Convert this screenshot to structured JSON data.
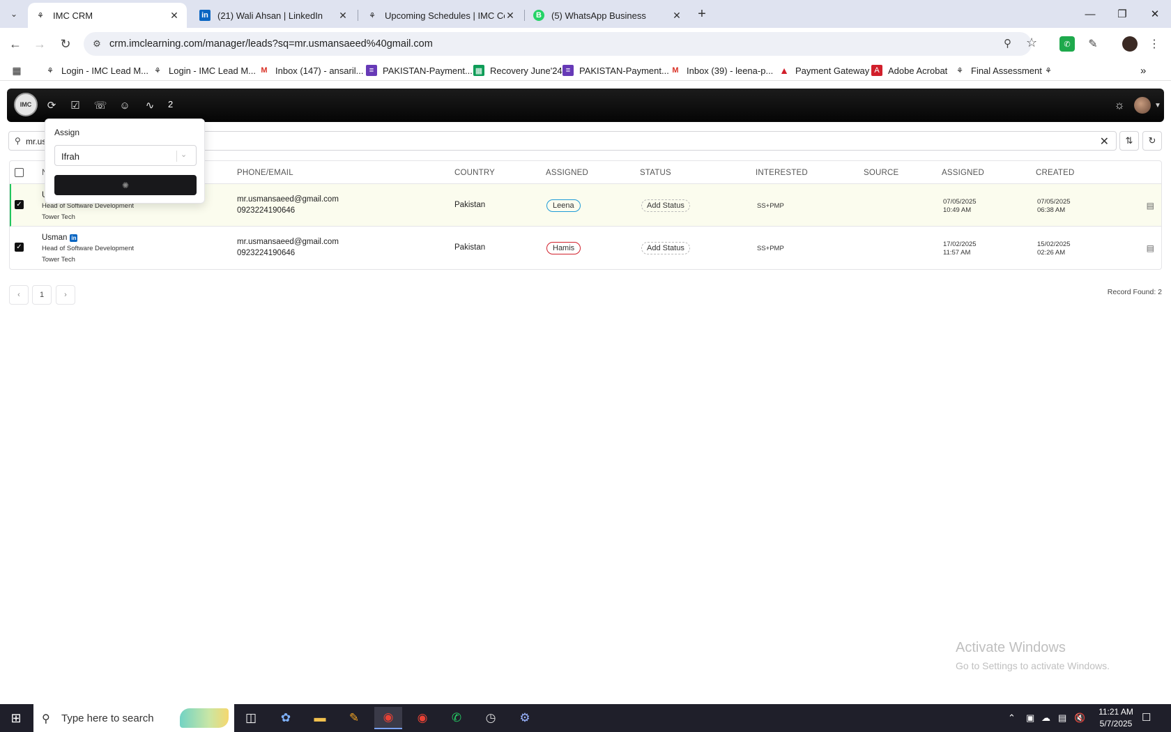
{
  "browser": {
    "tabs": [
      {
        "title": "IMC CRM",
        "active": true
      },
      {
        "title": "(21) Wali Ahsan | LinkedIn",
        "active": false
      },
      {
        "title": "Upcoming Schedules | IMC Cert",
        "active": false
      },
      {
        "title": "(5) WhatsApp Business",
        "active": false
      }
    ],
    "url": "crm.imclearning.com/manager/leads?sq=mr.usmansaeed%40gmail.com",
    "bookmarks": [
      "Login - IMC Lead M...",
      "Login - IMC Lead M...",
      "Inbox (147) - ansaril...",
      "PAKISTAN-Payment...",
      "Recovery June'24",
      "PAKISTAN-Payment...",
      "Inbox (39) - leena-p...",
      "Payment Gateway",
      "Adobe Acrobat",
      "Final Assessment"
    ]
  },
  "app": {
    "selected_count": "2",
    "search_value": "mr.us",
    "popover": {
      "title": "Assign",
      "select_value": "Ifrah"
    },
    "table": {
      "headers": [
        "N",
        "PHONE/EMAIL",
        "COUNTRY",
        "ASSIGNED",
        "STATUS",
        "INTERESTED",
        "SOURCE",
        "ASSIGNED",
        "CREATED"
      ],
      "rows": [
        {
          "name": "U",
          "title": "Head of Software Development",
          "company": "Tower Tech",
          "email": "mr.usmansaeed@gmail.com",
          "phone": "0923224190646",
          "country": "Pakistan",
          "assigned_to": "Leena",
          "status": "Add Status",
          "interested": "SS+PMP",
          "source": "",
          "assigned_date": "07/05/2025",
          "assigned_time": "10:49 AM",
          "created_date": "07/05/2025",
          "created_time": "06:38 AM"
        },
        {
          "name": "Usman",
          "title": "Head of Software Development",
          "company": "Tower Tech",
          "email": "mr.usmansaeed@gmail.com",
          "phone": "0923224190646",
          "country": "Pakistan",
          "assigned_to": "Hamis",
          "status": "Add Status",
          "interested": "SS+PMP",
          "source": "",
          "assigned_date": "17/02/2025",
          "assigned_time": "11:57 AM",
          "created_date": "15/02/2025",
          "created_time": "02:26 AM"
        }
      ]
    },
    "pagination": {
      "current_page": "1"
    },
    "record_count": "Record Found: 2"
  },
  "watermark": {
    "line1": "Activate Windows",
    "line2": "Go to Settings to activate Windows."
  },
  "taskbar": {
    "search_placeholder": "Type here to search",
    "time": "11:21 AM",
    "date": "5/7/2025"
  },
  "colors": {
    "accent_green": "#22c55e",
    "pill_blue": "#1e9bd7",
    "pill_red": "#d11f2b",
    "appbar": "#0b0b0b"
  }
}
